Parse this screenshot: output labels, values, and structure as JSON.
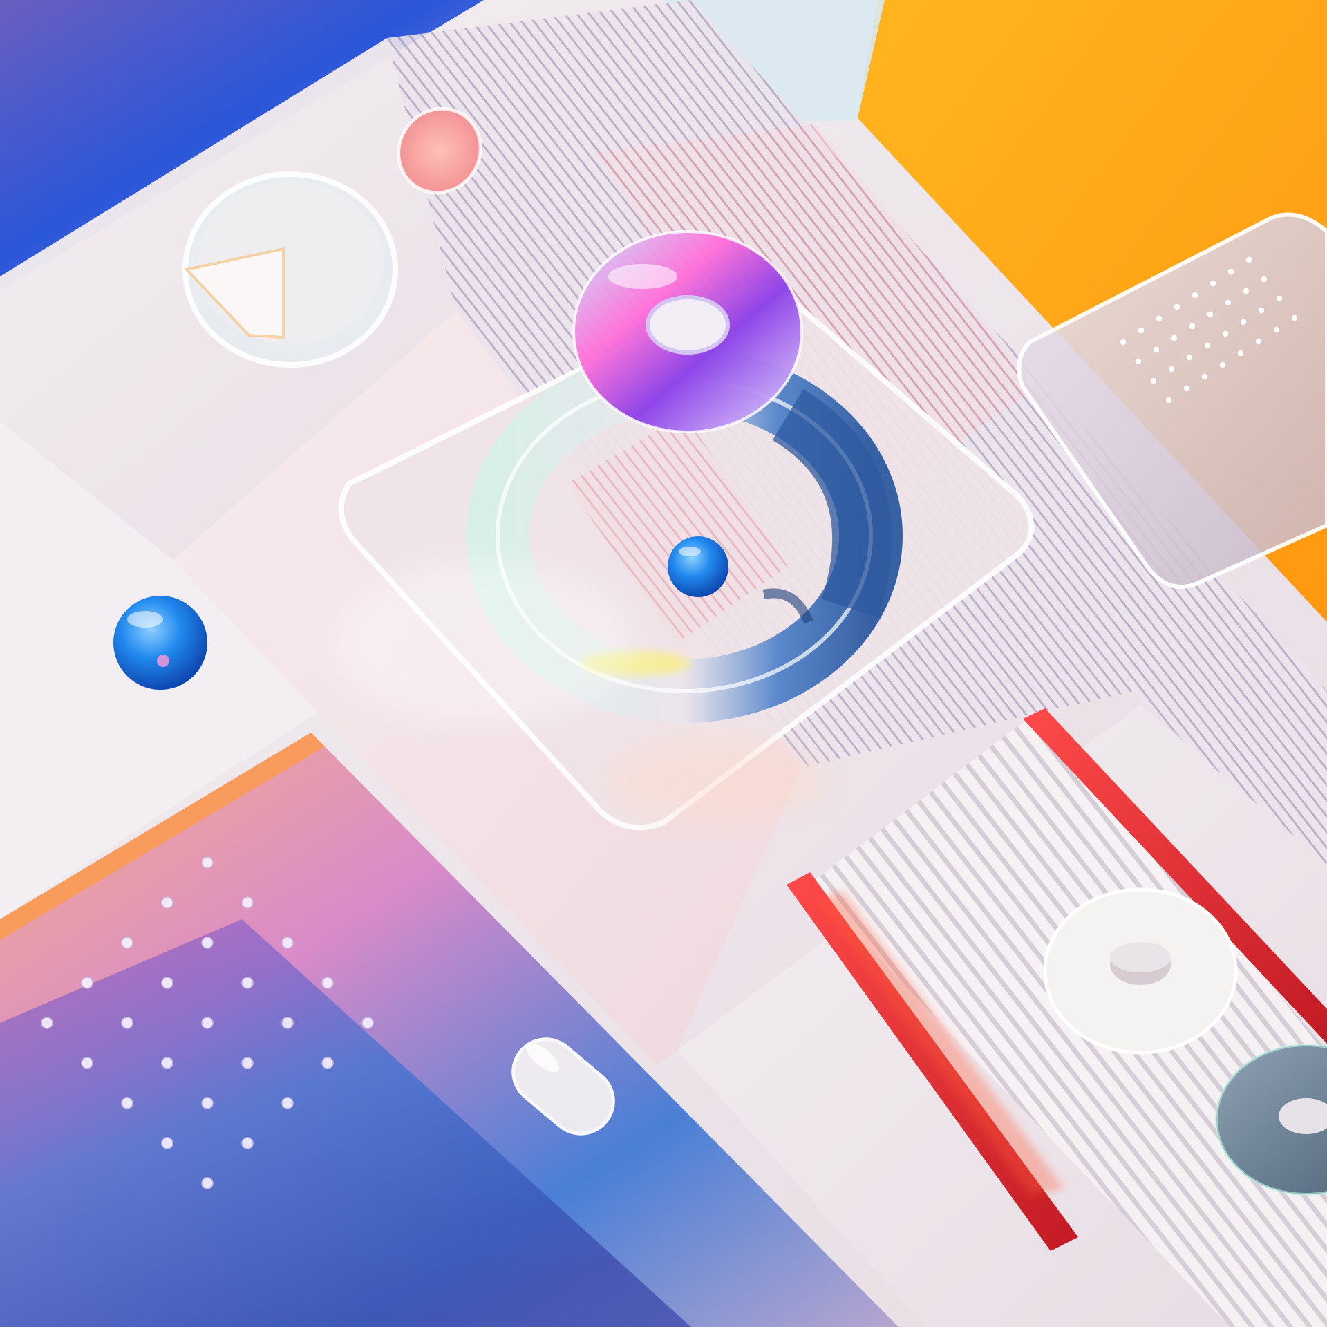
{
  "scene": {
    "palette": {
      "orange": "#ffab1e",
      "amber": "#ff9a10",
      "blue": "#1e78e6",
      "deep_blue": "#1f3fb0",
      "violet": "#8a4fc9",
      "pink": "#f06fb8",
      "red": "#e6282e",
      "frost": "#f2eef2",
      "glass_edge": "#ffffff"
    },
    "icons": {
      "large_torus": "torus-ring-icon",
      "floating_torus": "iridescent-donut-icon",
      "pie_disc": "pie-chart-disc-icon",
      "small_torus_white": "frosted-donut-icon",
      "small_torus_grey": "grey-donut-icon",
      "capsule": "capsule-pill-icon",
      "sphere_blue": "blue-sphere-icon",
      "lens_pink": "pink-lens-icon",
      "dot_grid": "dot-grid-icon",
      "ribbed_panel": "ribbed-glass-icon"
    },
    "pie": {
      "slice_fraction": 0.15
    }
  }
}
